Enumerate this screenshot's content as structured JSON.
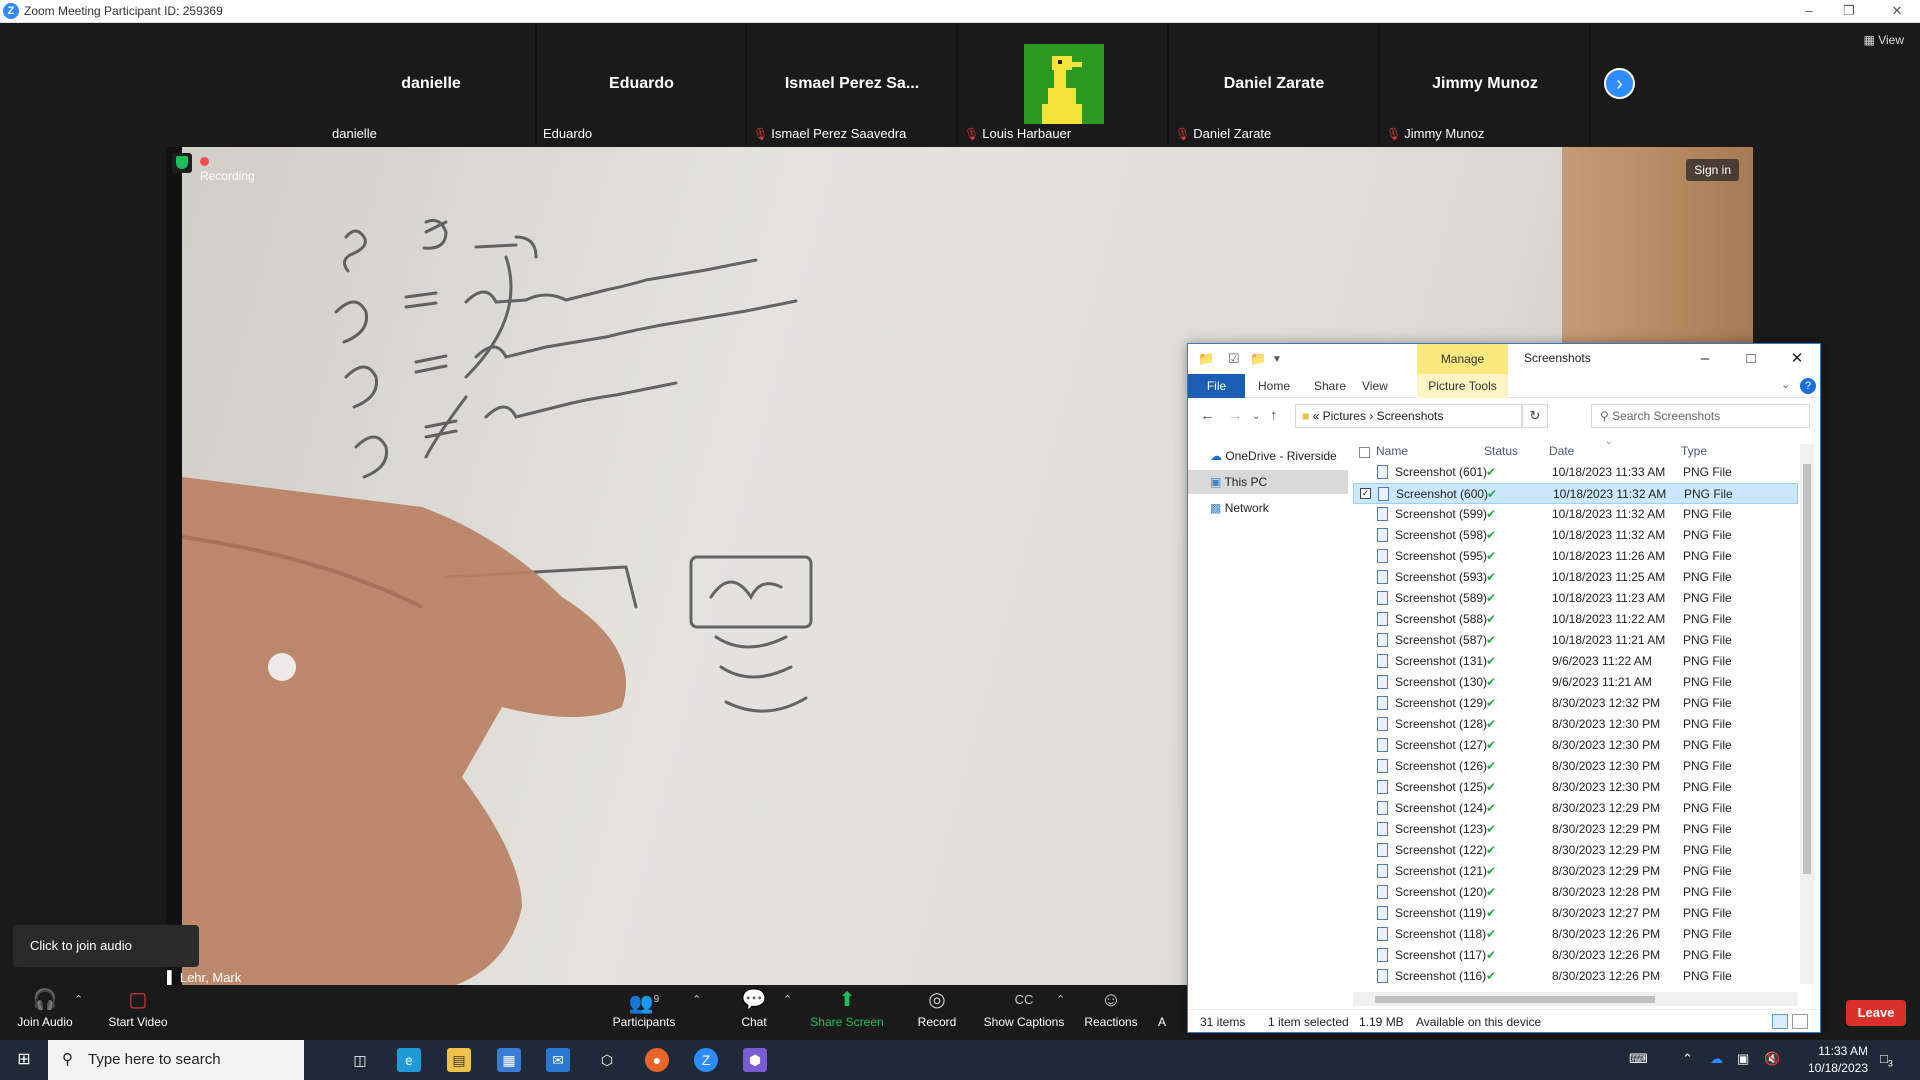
{
  "window": {
    "title": "Zoom Meeting Participant ID: 259369",
    "view_label": "View"
  },
  "gallery": [
    {
      "big": "danielle",
      "small": "danielle",
      "muted": false
    },
    {
      "big": "Eduardo",
      "small": "Eduardo",
      "muted": false
    },
    {
      "big": "Ismael Perez Sa...",
      "small": "Ismael Perez Saavedra",
      "muted": true
    },
    {
      "big": "",
      "small": "Louis Harbauer",
      "muted": true,
      "avatar": true
    },
    {
      "big": "Daniel Zarate",
      "small": "Daniel Zarate",
      "muted": true
    },
    {
      "big": "Jimmy Munoz",
      "small": "Jimmy Munoz",
      "muted": true
    }
  ],
  "share": {
    "recording": "Recording",
    "sign_in": "Sign in",
    "speaker": "Lehr, Mark"
  },
  "audio_popup": "Click to join audio",
  "toolbar": {
    "join_audio": "Join Audio",
    "start_video": "Start Video",
    "participants": "Participants",
    "participants_count": "9",
    "chat": "Chat",
    "share_screen": "Share Screen",
    "record": "Record",
    "show_captions": "Show Captions",
    "reactions": "Reactions",
    "apps_partial": "A",
    "leave": "Leave"
  },
  "explorer": {
    "title": "Screenshots",
    "manage_tab": "Manage",
    "picture_tools": "Picture Tools",
    "ribbon_tabs": [
      "File",
      "Home",
      "Share",
      "View"
    ],
    "address": {
      "parts": [
        "Pictures",
        "Screenshots"
      ],
      "prefix": "«"
    },
    "search_placeholder": "Search Screenshots",
    "nav": [
      "OneDrive - Riverside",
      "This PC",
      "Network"
    ],
    "columns": [
      "Name",
      "Status",
      "Date",
      "Type"
    ],
    "rows": [
      {
        "name": "Screenshot (601)",
        "date": "10/18/2023 11:33 AM",
        "type": "PNG File"
      },
      {
        "name": "Screenshot (600)",
        "date": "10/18/2023 11:32 AM",
        "type": "PNG File",
        "selected": true
      },
      {
        "name": "Screenshot (599)",
        "date": "10/18/2023 11:32 AM",
        "type": "PNG File"
      },
      {
        "name": "Screenshot (598)",
        "date": "10/18/2023 11:32 AM",
        "type": "PNG File"
      },
      {
        "name": "Screenshot (595)",
        "date": "10/18/2023 11:26 AM",
        "type": "PNG File"
      },
      {
        "name": "Screenshot (593)",
        "date": "10/18/2023 11:25 AM",
        "type": "PNG File"
      },
      {
        "name": "Screenshot (589)",
        "date": "10/18/2023 11:23 AM",
        "type": "PNG File"
      },
      {
        "name": "Screenshot (588)",
        "date": "10/18/2023 11:22 AM",
        "type": "PNG File"
      },
      {
        "name": "Screenshot (587)",
        "date": "10/18/2023 11:21 AM",
        "type": "PNG File"
      },
      {
        "name": "Screenshot (131)",
        "date": "9/6/2023 11:22 AM",
        "type": "PNG File"
      },
      {
        "name": "Screenshot (130)",
        "date": "9/6/2023 11:21 AM",
        "type": "PNG File"
      },
      {
        "name": "Screenshot (129)",
        "date": "8/30/2023 12:32 PM",
        "type": "PNG File"
      },
      {
        "name": "Screenshot (128)",
        "date": "8/30/2023 12:30 PM",
        "type": "PNG File"
      },
      {
        "name": "Screenshot (127)",
        "date": "8/30/2023 12:30 PM",
        "type": "PNG File"
      },
      {
        "name": "Screenshot (126)",
        "date": "8/30/2023 12:30 PM",
        "type": "PNG File"
      },
      {
        "name": "Screenshot (125)",
        "date": "8/30/2023 12:30 PM",
        "type": "PNG File"
      },
      {
        "name": "Screenshot (124)",
        "date": "8/30/2023 12:29 PM",
        "type": "PNG File"
      },
      {
        "name": "Screenshot (123)",
        "date": "8/30/2023 12:29 PM",
        "type": "PNG File"
      },
      {
        "name": "Screenshot (122)",
        "date": "8/30/2023 12:29 PM",
        "type": "PNG File"
      },
      {
        "name": "Screenshot (121)",
        "date": "8/30/2023 12:29 PM",
        "type": "PNG File"
      },
      {
        "name": "Screenshot (120)",
        "date": "8/30/2023 12:28 PM",
        "type": "PNG File"
      },
      {
        "name": "Screenshot (119)",
        "date": "8/30/2023 12:27 PM",
        "type": "PNG File"
      },
      {
        "name": "Screenshot (118)",
        "date": "8/30/2023 12:26 PM",
        "type": "PNG File"
      },
      {
        "name": "Screenshot (117)",
        "date": "8/30/2023 12:26 PM",
        "type": "PNG File"
      },
      {
        "name": "Screenshot (116)",
        "date": "8/30/2023 12:26 PM",
        "type": "PNG File"
      }
    ],
    "status": {
      "count": "31 items",
      "selected": "1 item selected",
      "size": "1.19 MB",
      "availability": "Available on this device"
    }
  },
  "taskbar": {
    "search_placeholder": "Type here to search",
    "time": "11:33 AM",
    "date": "10/18/2023",
    "notifications": "3"
  },
  "colors": {
    "zoom_blue": "#2d8cff",
    "leave_red": "#d9302c",
    "share_green": "#19c35a",
    "taskbar": "#1f2a38",
    "selection": "#cce8ff"
  }
}
